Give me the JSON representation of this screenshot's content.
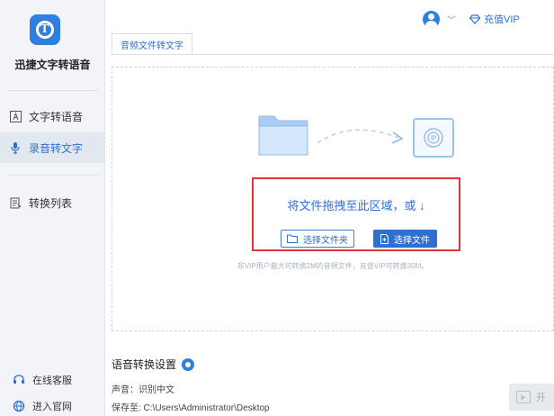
{
  "app": {
    "name": "迅捷文字转语音"
  },
  "sidebar": {
    "items": [
      {
        "label": "文字转语音",
        "icon": "text-a-icon",
        "active": false
      },
      {
        "label": "录音转文字",
        "icon": "microphone-icon",
        "active": true
      },
      {
        "label": "转换列表",
        "icon": "list-icon",
        "active": false
      }
    ],
    "bottom": [
      {
        "label": "在线客服",
        "icon": "headset-icon"
      },
      {
        "label": "进入官网",
        "icon": "globe-icon"
      }
    ]
  },
  "topbar": {
    "vip_label": "充值VIP"
  },
  "tabs": [
    {
      "label": "音频文件转文字"
    }
  ],
  "dropzone": {
    "prompt": "将文件拖拽至此区域，或 ↓",
    "select_folder": "选择文件夹",
    "select_file": "选择文件",
    "note": "非VIP用户最大可转换2M的音频文件，充值VIP可转换30M。"
  },
  "settings": {
    "title": "语音转换设置",
    "voice_label": "声音：识别中文",
    "save_label": "保存至: C:\\Users\\Administrator\\Desktop"
  },
  "start_button": {
    "label": "开"
  },
  "colors": {
    "accent": "#2f6fd1",
    "highlight": "#d9363e",
    "sidebar_bg": "#f2f4f7"
  }
}
